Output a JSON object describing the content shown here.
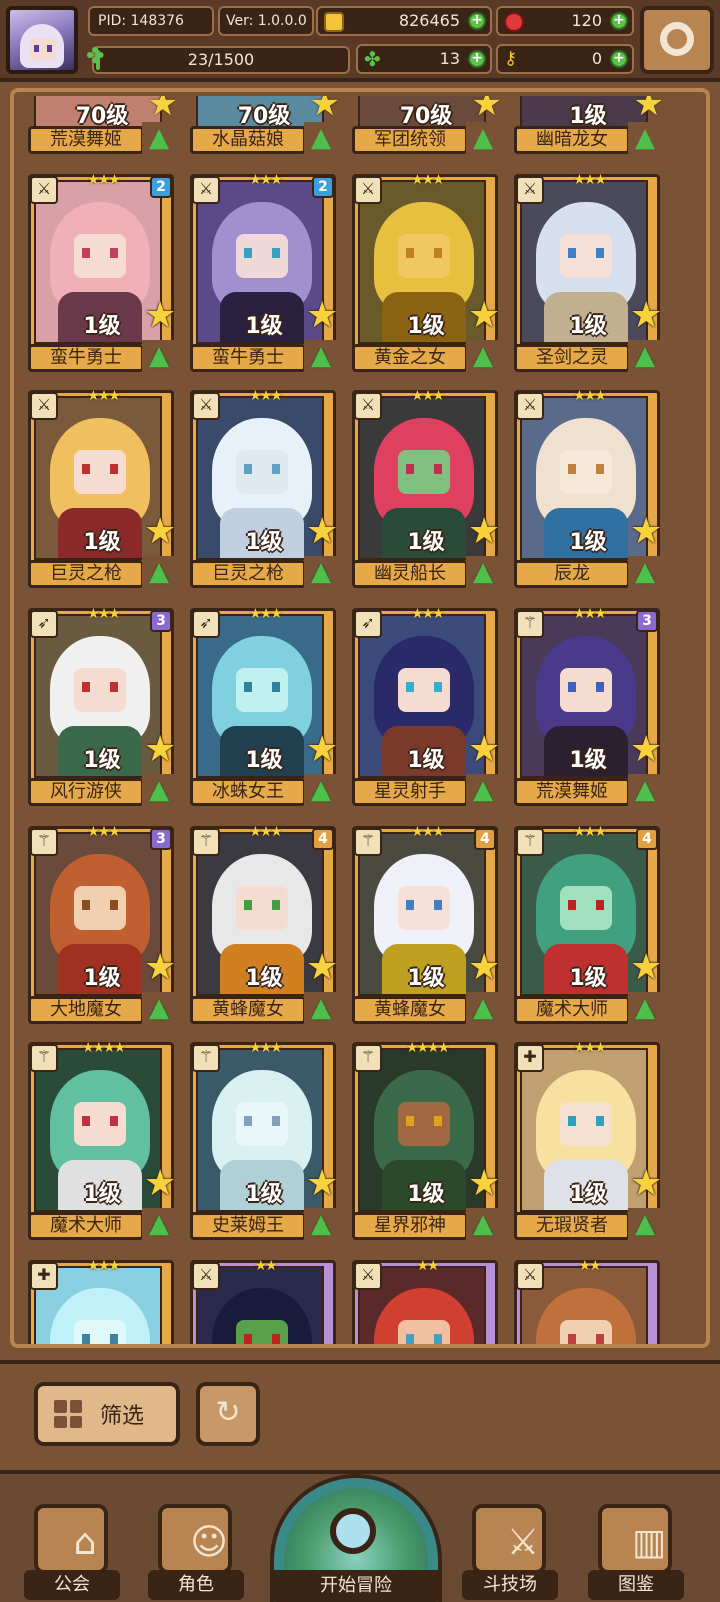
{
  "header": {
    "pid": "PID: 148376",
    "version": "Ver: 1.0.0.0",
    "gold": "826465",
    "gems": "120",
    "clover": "13",
    "keys": "0",
    "exp_text": "23/1500",
    "exp_fill": 0.0153
  },
  "top_row": [
    {
      "level": "70级",
      "name": "荒漠舞姬"
    },
    {
      "level": "70级",
      "name": "水晶菇娘"
    },
    {
      "level": "70级",
      "name": "军团统领"
    },
    {
      "level": "1级",
      "name": "幽暗龙女"
    }
  ],
  "cards": [
    {
      "name": "蛮牛勇士",
      "level": "1级",
      "stars": "★★★",
      "tier": "2",
      "weapon": "⚔"
    },
    {
      "name": "蛮牛勇士",
      "level": "1级",
      "stars": "★★★",
      "tier": "2",
      "weapon": "⚔"
    },
    {
      "name": "黄金之女",
      "level": "1级",
      "stars": "★★★",
      "tier": "",
      "weapon": "⚔"
    },
    {
      "name": "圣剑之灵",
      "level": "1级",
      "stars": "★★★",
      "tier": "",
      "weapon": "⚔"
    },
    {
      "name": "巨灵之枪",
      "level": "1级",
      "stars": "★★★",
      "tier": "",
      "weapon": "⚔"
    },
    {
      "name": "巨灵之枪",
      "level": "1级",
      "stars": "★★★",
      "tier": "",
      "weapon": "⚔"
    },
    {
      "name": "幽灵船长",
      "level": "1级",
      "stars": "★★★",
      "tier": "",
      "weapon": "⚔"
    },
    {
      "name": "辰龙",
      "level": "1级",
      "stars": "★★★",
      "tier": "",
      "weapon": "⚔"
    },
    {
      "name": "风行游侠",
      "level": "1级",
      "stars": "★★★",
      "tier": "3",
      "weapon": "➶"
    },
    {
      "name": "冰蛛女王",
      "level": "1级",
      "stars": "★★★",
      "tier": "",
      "weapon": "➶"
    },
    {
      "name": "星灵射手",
      "level": "1级",
      "stars": "★★★",
      "tier": "",
      "weapon": "➶"
    },
    {
      "name": "荒漠舞姬",
      "level": "1级",
      "stars": "★★★",
      "tier": "3",
      "weapon": "⚚"
    },
    {
      "name": "大地魔女",
      "level": "1级",
      "stars": "★★★",
      "tier": "3",
      "weapon": "⚚"
    },
    {
      "name": "黄蜂魔女",
      "level": "1级",
      "stars": "★★★",
      "tier": "4",
      "weapon": "⚚"
    },
    {
      "name": "黄蜂魔女",
      "level": "1级",
      "stars": "★★★",
      "tier": "4",
      "weapon": "⚚"
    },
    {
      "name": "魔术大师",
      "level": "1级",
      "stars": "★★★",
      "tier": "4",
      "weapon": "⚚"
    },
    {
      "name": "魔术大师",
      "level": "1级",
      "stars": "★★★★",
      "tier": "",
      "weapon": "⚚"
    },
    {
      "name": "史莱姆王",
      "level": "1级",
      "stars": "★★★",
      "tier": "",
      "weapon": "⚚"
    },
    {
      "name": "星界邪神",
      "level": "1级",
      "stars": "★★★★",
      "tier": "",
      "weapon": "⚚"
    },
    {
      "name": "无瑕贤者",
      "level": "1级",
      "stars": "★★★",
      "tier": "",
      "weapon": "✚"
    }
  ],
  "partial_row": [
    {
      "stars": "★★★",
      "weapon": "✚"
    },
    {
      "stars": "★★",
      "weapon": "⚔"
    },
    {
      "stars": "★★",
      "weapon": "⚔"
    },
    {
      "stars": "★★",
      "weapon": "⚔"
    }
  ],
  "controls": {
    "filter_label": "筛选",
    "refresh_icon": "↻"
  },
  "nav": {
    "guild": "公会",
    "roles": "角色",
    "adventure": "开始冒险",
    "arena": "斗技场",
    "codex": "图鉴"
  },
  "colors": {
    "tier2": "#3aa0e0",
    "tier3": "#8a6ad0",
    "tier4": "#e0a040"
  }
}
